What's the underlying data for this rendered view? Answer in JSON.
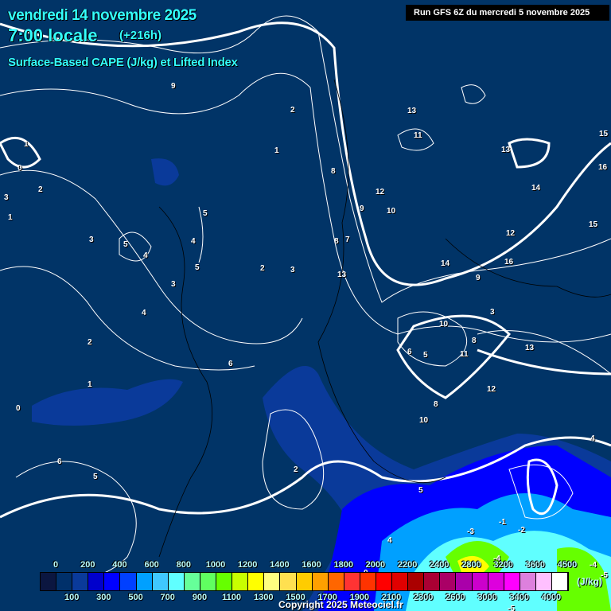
{
  "header": {
    "date": "vendredi 14 novembre 2025",
    "time": "7:00 locale",
    "lead": "(+216h)",
    "parameter": "Surface-Based CAPE (J/kg) et Lifted Index",
    "run": "Run GFS 6Z du mercredi 5 novembre 2025"
  },
  "colorbar": {
    "unit": "(J/kg)",
    "top_labels": [
      "0",
      "200",
      "400",
      "600",
      "800",
      "1000",
      "1200",
      "1400",
      "1600",
      "1800",
      "2000",
      "2200",
      "2400",
      "2800",
      "3200",
      "3600",
      "4500"
    ],
    "bottom_labels": [
      "100",
      "300",
      "500",
      "700",
      "900",
      "1100",
      "1300",
      "1500",
      "1700",
      "1900",
      "2100",
      "2300",
      "2600",
      "3000",
      "3400",
      "4000"
    ],
    "colors": [
      "#0b1640",
      "#00306a",
      "#0a3a9a",
      "#0000cc",
      "#0000ff",
      "#0040ff",
      "#00a0ff",
      "#40c8ff",
      "#60ffff",
      "#66ff99",
      "#60ff60",
      "#66ff00",
      "#c8ff00",
      "#ffff00",
      "#ffff80",
      "#ffe050",
      "#ffcc00",
      "#ffa000",
      "#ff6600",
      "#ff3333",
      "#ff3300",
      "#ff0000",
      "#e00000",
      "#aa0000",
      "#aa0033",
      "#aa0066",
      "#aa00aa",
      "#cc00cc",
      "#dd00dd",
      "#ff00ff",
      "#dd80dd",
      "#ffc0ff",
      "#ffffff"
    ]
  },
  "lifted_index_labels": [
    "1",
    "0",
    "2",
    "3",
    "1",
    "9",
    "2",
    "1",
    "8",
    "9",
    "10",
    "11",
    "13",
    "12",
    "13",
    "15",
    "16",
    "15",
    "14",
    "12",
    "13",
    "16",
    "5",
    "4",
    "5",
    "2",
    "3",
    "5",
    "4",
    "3",
    "2",
    "1",
    "0",
    "6",
    "5",
    "4",
    "3",
    "2",
    "8",
    "7",
    "6",
    "5",
    "4",
    "3",
    "11",
    "12",
    "10",
    "8",
    "9",
    "14",
    "10",
    "13",
    "8",
    "6",
    "5",
    "4",
    "0",
    "-1",
    "-2",
    "-3",
    "-4",
    "-5",
    "-4",
    "-5"
  ],
  "copyright": "Copyright 2025 Meteociel.fr"
}
